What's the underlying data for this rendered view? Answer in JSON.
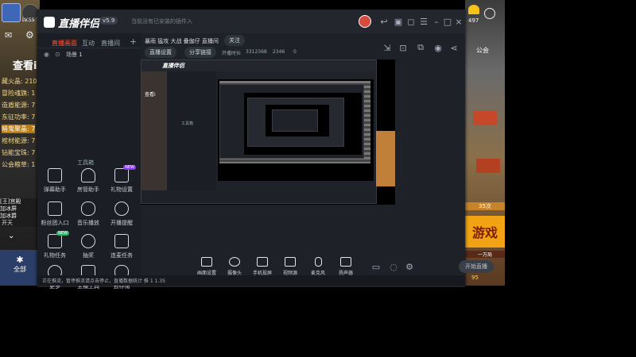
{
  "left_panel": {
    "level_badge": "LV.55",
    "header": "查看i",
    "rows": [
      "藏火晶: 210",
      "冒险魂旗: 1",
      "造盾能源: 7",
      "东征功率: 7",
      "暗鬼聚晶: 7",
      "棺材能源: 7",
      "钻能宝珠: 7",
      "公会粮草: 1"
    ],
    "bottom_chat": "[王]宫殿\n加冰屏\n加冰爵",
    "bottom_labels": [
      "开天"
    ],
    "fullscreen_label": "全部"
  },
  "right_panel": {
    "coin_count": "497",
    "label_top": "公会",
    "banner_text": "游戏",
    "rank_text": "35次",
    "rank_label": "一万局",
    "coin_bottom": "95"
  },
  "app": {
    "brand": "直播伴侣",
    "version_badge": "v5.9",
    "title_tip": "当前没有已安装的插件入",
    "sidebar_tabs": [
      "直播画面",
      "互动",
      "直播间",
      "+"
    ],
    "sidebar_scene": "场景 1",
    "tools_header": "工具箱",
    "tools": [
      {
        "label": "弹幕助手",
        "badge": ""
      },
      {
        "label": "房管助手",
        "badge": ""
      },
      {
        "label": "礼物设置",
        "badge": "NEW"
      },
      {
        "label": "粉丝团入口",
        "badge": ""
      },
      {
        "label": "音乐播放",
        "badge": ""
      },
      {
        "label": "开播提醒",
        "badge": ""
      },
      {
        "label": "礼物任务",
        "badge": "NEW"
      },
      {
        "label": "抽奖",
        "badge": ""
      },
      {
        "label": "连麦任务",
        "badge": ""
      },
      {
        "label": "更多",
        "badge": ""
      },
      {
        "label": "主播工具",
        "badge": ""
      },
      {
        "label": "云存储",
        "badge": ""
      }
    ],
    "main_header": {
      "title": "暴雨 猛攻 大战 叠伽仔 直播间",
      "follow_label": "关注",
      "tag1": "直播设置",
      "tag2": "分享链接",
      "stats": [
        "开播时长",
        "3312368",
        "2346",
        "0"
      ]
    },
    "preview": {
      "inner_brand": "直播伴侣",
      "inner_title": "查看i",
      "inner_tools_header": "工具箱"
    },
    "bottom_toolbar": [
      "画面设置",
      "摄像头",
      "手机投屏",
      "视频源",
      "麦克风",
      "扬声器"
    ],
    "start_button": "开始直播",
    "status_text": "正在推流，暂停推流请点击停止，直播数据统计 推 1 1.3S"
  }
}
